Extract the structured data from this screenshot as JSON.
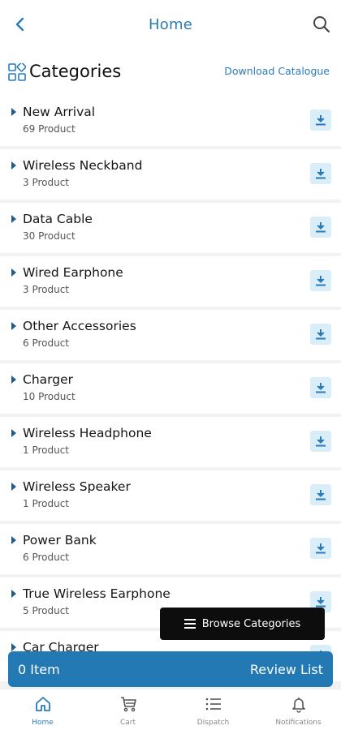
{
  "header": {
    "title": "Home",
    "back_icon": "chevron-left-icon",
    "search_icon": "search-icon"
  },
  "section": {
    "title": "Categories",
    "icon": "categories-icon",
    "download_label": "Download Catalogue"
  },
  "categories": [
    {
      "name": "New Arrival",
      "count": "69 Product"
    },
    {
      "name": "Wireless Neckband",
      "count": "3 Product"
    },
    {
      "name": "Data Cable",
      "count": "30 Product"
    },
    {
      "name": "Wired Earphone",
      "count": "3 Product"
    },
    {
      "name": "Other Accessories",
      "count": "6 Product"
    },
    {
      "name": "Charger",
      "count": "10 Product"
    },
    {
      "name": "Wireless Headphone",
      "count": "1 Product"
    },
    {
      "name": "Wireless Speaker",
      "count": "1 Product"
    },
    {
      "name": "Power Bank",
      "count": "6 Product"
    },
    {
      "name": "True Wireless Earphone",
      "count": "5 Product"
    },
    {
      "name": "Car Charger",
      "count": ""
    }
  ],
  "browse": {
    "label": "Browse Categories",
    "icon": "menu-icon"
  },
  "review": {
    "item_count": "0 Item",
    "label": "Review List"
  },
  "nav": [
    {
      "label": "Home",
      "icon": "home-icon",
      "active": true
    },
    {
      "label": "Cart",
      "icon": "cart-icon",
      "active": false
    },
    {
      "label": "Dispatch",
      "icon": "list-icon",
      "active": false
    },
    {
      "label": "Notifications",
      "icon": "bell-icon",
      "active": false
    }
  ],
  "colors": {
    "accent": "#2b7bb9",
    "review_bar": "#2279b4",
    "download_bg": "#d9eef9",
    "browse_bg": "#0d0d0d"
  }
}
